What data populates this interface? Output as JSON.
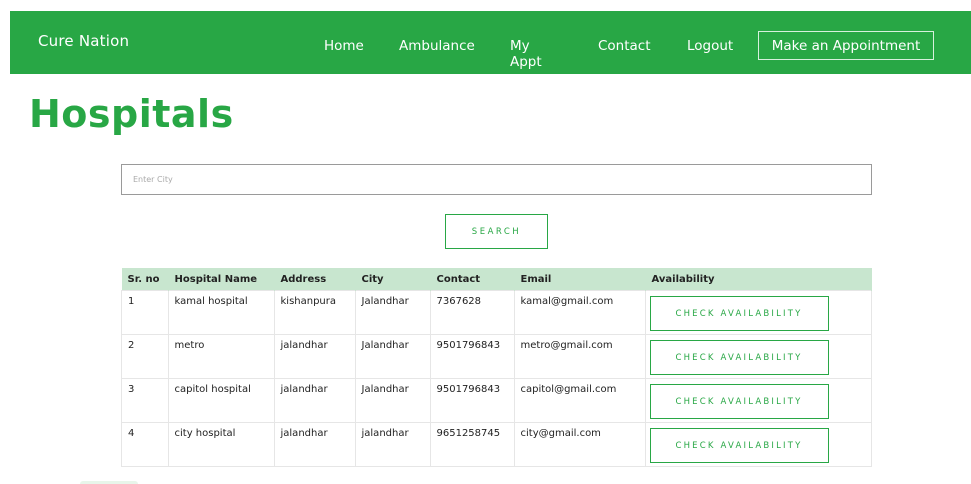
{
  "nav": {
    "brand": "Cure Nation",
    "links": [
      "Home",
      "Ambulance",
      "My Appt",
      "Contact",
      "Logout"
    ],
    "appointment_button": "Make an Appointment"
  },
  "page": {
    "title": "Hospitals"
  },
  "search": {
    "placeholder": "Enter City",
    "value": "",
    "button": "SEARCH"
  },
  "table": {
    "headers": [
      "Sr. no",
      "Hospital Name",
      "Address",
      "City",
      "Contact",
      "Email",
      "Availability"
    ],
    "rows": [
      {
        "sr": "1",
        "name": "kamal hospital",
        "address": "kishanpura",
        "city": "Jalandhar",
        "contact": "7367628",
        "email": "kamal@gmail.com",
        "action": "CHECK AVAILABILITY"
      },
      {
        "sr": "2",
        "name": "metro",
        "address": "jalandhar",
        "city": "Jalandhar",
        "contact": "9501796843",
        "email": "metro@gmail.com",
        "action": "CHECK AVAILABILITY"
      },
      {
        "sr": "3",
        "name": "capitol hospital",
        "address": "jalandhar",
        "city": "Jalandhar",
        "contact": "9501796843",
        "email": "capitol@gmail.com",
        "action": "CHECK AVAILABILITY"
      },
      {
        "sr": "4",
        "name": "city hospital",
        "address": "jalandhar",
        "city": "jalandhar",
        "contact": "9651258745",
        "email": "city@gmail.com",
        "action": "CHECK AVAILABILITY"
      }
    ]
  },
  "colors": {
    "primary": "#28a745",
    "header_row": "#c8e6cf",
    "background": "#ffffff"
  }
}
